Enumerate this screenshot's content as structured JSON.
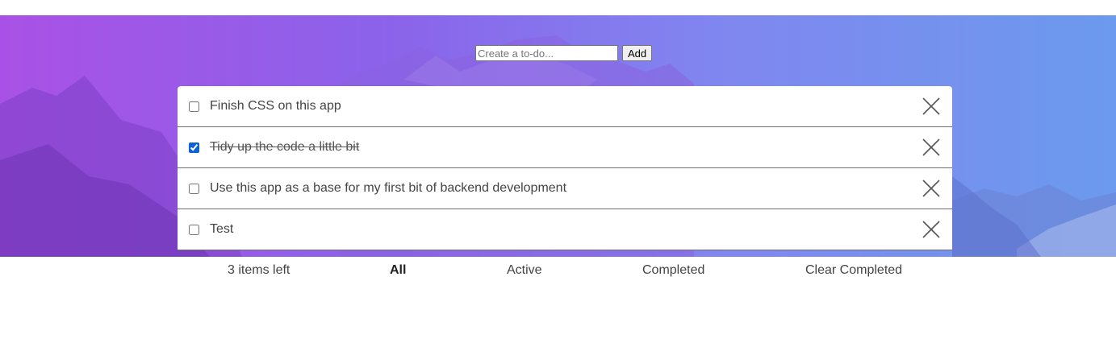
{
  "form": {
    "placeholder": "Create a to-do...",
    "value": "",
    "add_label": "Add"
  },
  "todos": [
    {
      "text": "Finish CSS on this app",
      "done": false
    },
    {
      "text": "Tidy up the code a little bit",
      "done": true
    },
    {
      "text": "Use this app as a base for my first bit of backend development",
      "done": false
    },
    {
      "text": "Test",
      "done": false
    }
  ],
  "footer": {
    "items_left": "3 items left",
    "filter_all": "All",
    "filter_active": "Active",
    "filter_completed": "Completed",
    "clear_completed": "Clear Completed",
    "active_filter": "All"
  },
  "icons": {
    "delete": "close-icon"
  },
  "colors": {
    "gradient_left": "#a951e6",
    "gradient_right": "#6b9aee",
    "checkbox_accent": "#0b63d6"
  }
}
